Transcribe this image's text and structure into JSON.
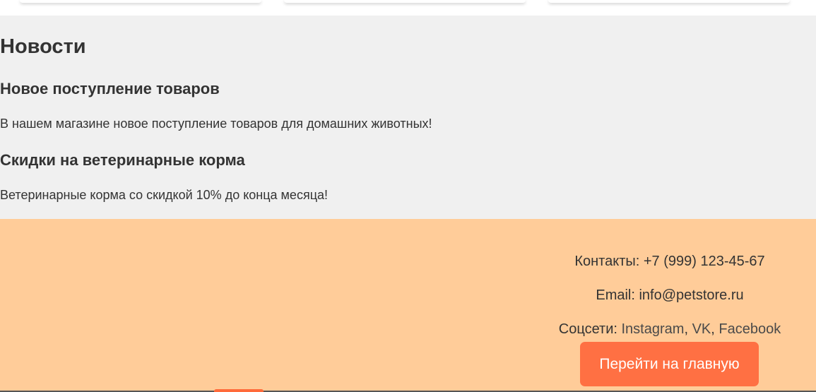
{
  "news": {
    "heading": "Новости",
    "items": [
      {
        "title": "Новое поступление товаров",
        "text": "В нашем магазине новое поступление товаров для домашних животных!"
      },
      {
        "title": "Скидки на ветеринарные корма",
        "text": "Ветеринарные корма со скидкой 10% до конца месяца!"
      }
    ]
  },
  "footer": {
    "contacts": "Контакты: +7 (999) 123-45-67",
    "email": "Email: info@petstore.ru",
    "social_label": "Соцсети:",
    "social_links": [
      "Instagram",
      "VK",
      "Facebook"
    ],
    "home_button": "Перейти на главную"
  },
  "colors": {
    "news_background": "#f0f0f0",
    "footer_background": "#ffcc99",
    "button_background": "#ff7043",
    "text": "#333333"
  }
}
